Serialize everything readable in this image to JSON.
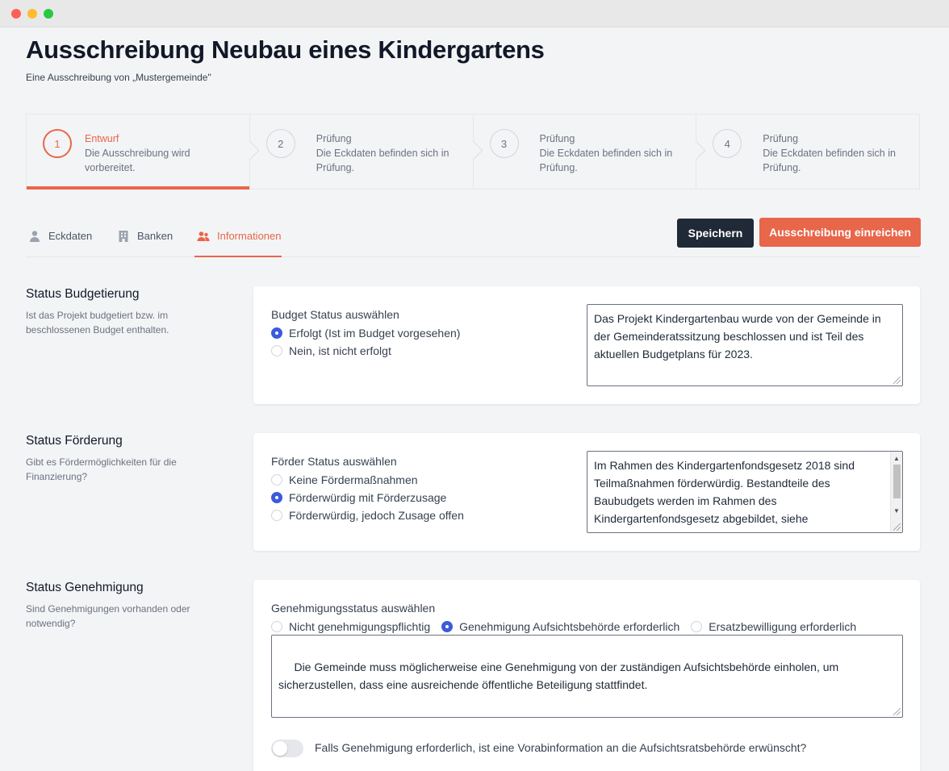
{
  "page": {
    "title": "Ausschreibung Neubau eines Kindergartens",
    "subtitle": "Eine Ausschreibung von „Mustergemeinde\""
  },
  "stepper": [
    {
      "number": "1",
      "title": "Entwurf",
      "desc": "Die Ausschreibung wird vorbereitet.",
      "active": true
    },
    {
      "number": "2",
      "title": "Prüfung",
      "desc": "Die Eckdaten befinden sich in Prüfung.",
      "active": false
    },
    {
      "number": "3",
      "title": "Prüfung",
      "desc": "Die Eckdaten befinden sich in Prüfung.",
      "active": false
    },
    {
      "number": "4",
      "title": "Prüfung",
      "desc": "Die Eckdaten befinden sich in Prüfung.",
      "active": false
    }
  ],
  "tabs": [
    {
      "label": "Eckdaten",
      "icon": "user-icon"
    },
    {
      "label": "Banken",
      "icon": "building-icon"
    },
    {
      "label": "Informationen",
      "icon": "users-icon",
      "active": true
    }
  ],
  "actions": {
    "save": "Speichern",
    "submit": "Ausschreibung einreichen"
  },
  "colors": {
    "accent": "#e8664a",
    "dark_button": "#1f2937",
    "radio_checked": "#3b5bdb"
  },
  "sections": {
    "budget": {
      "title": "Status Budgetierung",
      "desc": "Ist das Projekt budgetiert bzw. im beschlossenen Budget enthalten.",
      "legend": "Budget Status auswählen",
      "options": [
        {
          "label": "Erfolgt (Ist im Budget vorgesehen)",
          "checked": true
        },
        {
          "label": "Nein, ist nicht erfolgt",
          "checked": false
        }
      ],
      "text": "Das Projekt Kindergartenbau wurde von der Gemeinde in der Gemeinderatssitzung beschlossen und ist Teil des aktuellen Budgetplans für 2023."
    },
    "foerderung": {
      "title": "Status Förderung",
      "desc": "Gibt es Fördermöglichkeiten für die Finanzierung?",
      "legend": "Förder Status auswählen",
      "options": [
        {
          "label": "Keine Fördermaßnahmen",
          "checked": false
        },
        {
          "label": "Förderwürdig mit Förderzusage",
          "checked": true
        },
        {
          "label": "Förderwürdig, jedoch Zusage offen",
          "checked": false
        }
      ],
      "text": "Im Rahmen des Kindergartenfondsgesetz 2018 sind Teilmaßnahmen förderwürdig. Bestandteile des Baubudgets werden im Rahmen des Kindergartenfondsgesetz abgebildet, siehe Projektdokumente."
    },
    "genehmigung": {
      "title": "Status Genehmigung",
      "desc": "Sind Genehmigungen vorhanden oder notwendig?",
      "legend": "Genehmigungsstatus auswählen",
      "options": [
        {
          "label": "Nicht genehmigungspflichtig",
          "checked": false
        },
        {
          "label": "Genehmigung Aufsichtsbehörde erforderlich",
          "checked": true
        },
        {
          "label": "Ersatzbewilligung erforderlich",
          "checked": false
        }
      ],
      "text": " Die Gemeinde muss möglicherweise eine Genehmigung von der zuständigen Aufsichtsbehörde einholen, um sicherzustellen, dass eine ausreichende öffentliche Beteiligung stattfindet.",
      "toggle_label": "Falls Genehmigung erforderlich, ist eine Vorabinformation an die Aufsichtsratsbehörde erwünscht?",
      "toggle_on": false
    }
  }
}
